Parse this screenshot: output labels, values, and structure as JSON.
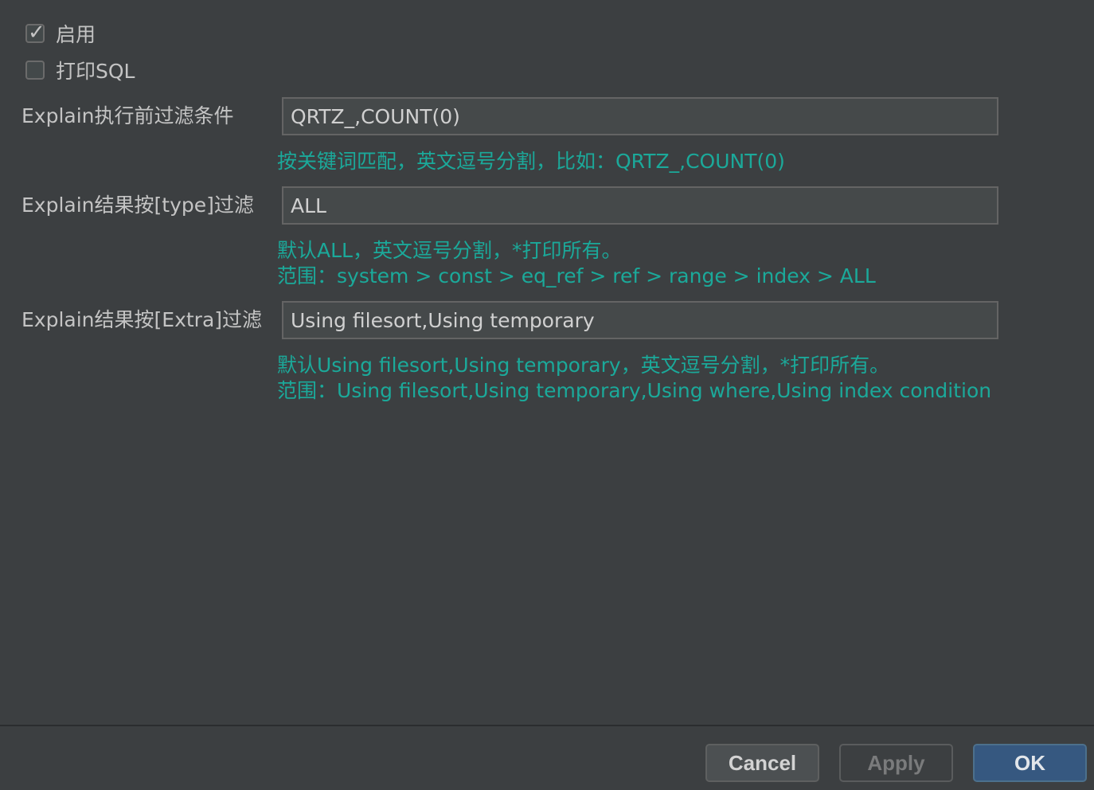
{
  "options": {
    "enable": {
      "label": "启用",
      "checked": true
    },
    "print_sql": {
      "label": "打印SQL",
      "checked": false
    }
  },
  "fields": [
    {
      "label": "Explain执行前过滤条件",
      "value": "QRTZ_,COUNT(0)",
      "hint_lines": [
        "按关键词匹配，英文逗号分割，比如：QRTZ_,COUNT(0)"
      ]
    },
    {
      "label": "Explain结果按[type]过滤",
      "value": "ALL",
      "hint_lines": [
        "默认ALL，英文逗号分割，*打印所有。",
        "范围：system > const > eq_ref > ref > range > index > ALL"
      ]
    },
    {
      "label": "Explain结果按[Extra]过滤",
      "value": "Using filesort,Using temporary",
      "hint_lines": [
        "默认Using filesort,Using temporary，英文逗号分割，*打印所有。",
        "范围：Using filesort,Using temporary,Using where,Using index condition"
      ]
    }
  ],
  "buttons": {
    "cancel": "Cancel",
    "apply": "Apply",
    "ok": "OK"
  },
  "colors": {
    "background": "#3c3f41",
    "hint_text": "#1ba99a",
    "primary_button": "#365880"
  }
}
